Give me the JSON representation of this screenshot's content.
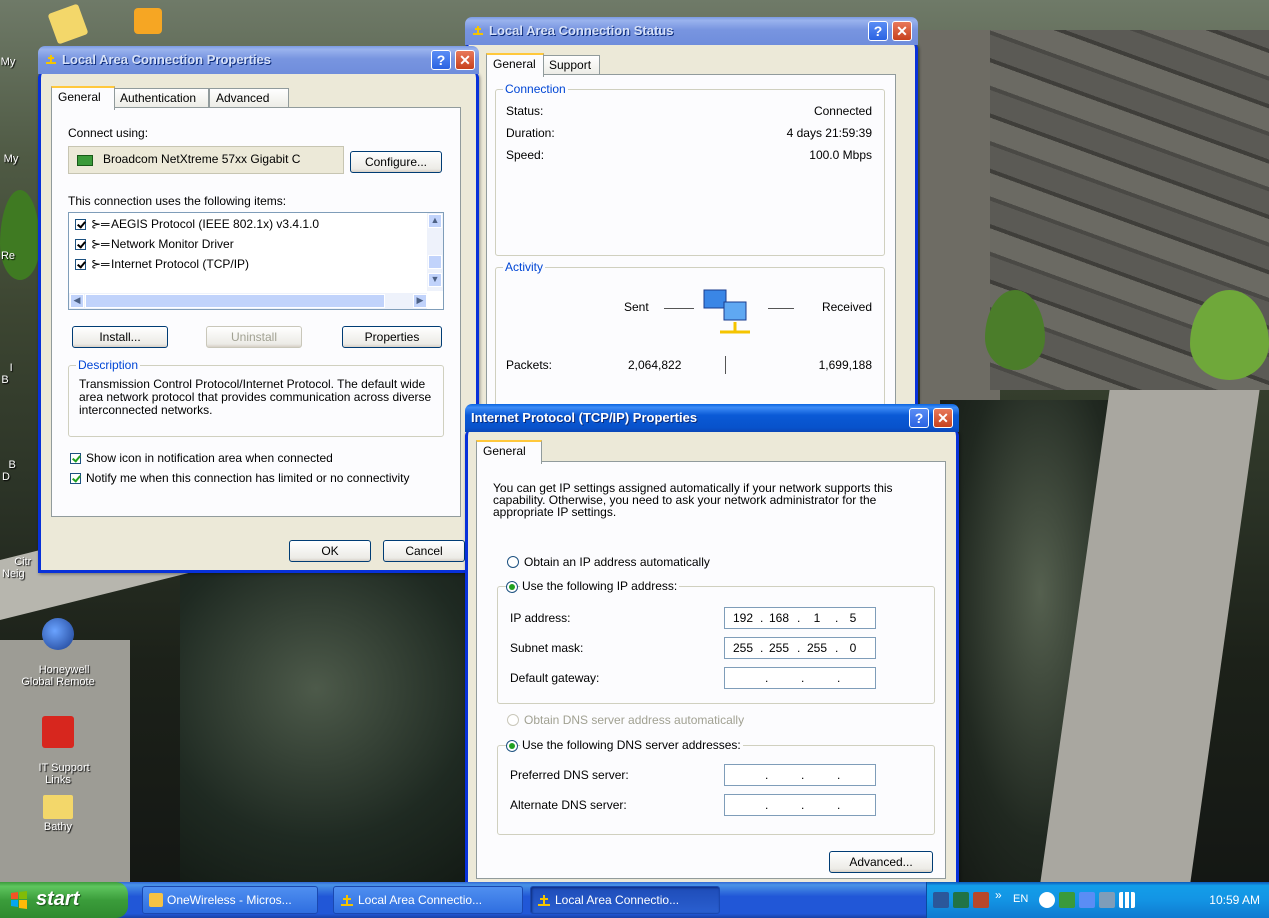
{
  "desktop": {
    "icons": [
      {
        "label": "My"
      },
      {
        "label": "My"
      },
      {
        "label": "Re"
      },
      {
        "label": "I\nB"
      },
      {
        "label": "B\nD"
      },
      {
        "label": "Citr\nNeig"
      },
      {
        "label": "Honeywell\nGlobal Remote"
      },
      {
        "label": "IT Support\nLinks"
      },
      {
        "label": "Bathy"
      }
    ]
  },
  "lac_properties": {
    "title": "Local Area Connection Properties",
    "tabs": [
      "General",
      "Authentication",
      "Advanced"
    ],
    "connect_using_label": "Connect using:",
    "adapter_name": "Broadcom NetXtreme 57xx Gigabit C",
    "configure_label": "Configure...",
    "items_label": "This connection uses the following items:",
    "items": [
      {
        "label": "AEGIS Protocol (IEEE 802.1x) v3.4.1.0"
      },
      {
        "label": "Network Monitor Driver"
      },
      {
        "label": "Internet Protocol (TCP/IP)"
      }
    ],
    "install_label": "Install...",
    "uninstall_label": "Uninstall",
    "properties_label": "Properties",
    "description_title": "Description",
    "description_text": "Transmission Control Protocol/Internet Protocol. The default wide area network protocol that provides communication across diverse interconnected networks.",
    "show_icon_label": "Show icon in notification area when connected",
    "notify_label": "Notify me when this connection has limited or no connectivity",
    "ok_label": "OK",
    "cancel_label": "Cancel"
  },
  "lac_status": {
    "title": "Local Area Connection Status",
    "tabs": [
      "General",
      "Support"
    ],
    "connection_title": "Connection",
    "status_label": "Status:",
    "status_value": "Connected",
    "duration_label": "Duration:",
    "duration_value": "4 days 21:59:39",
    "speed_label": "Speed:",
    "speed_value": "100.0 Mbps",
    "activity_title": "Activity",
    "sent_label": "Sent",
    "received_label": "Received",
    "packets_label": "Packets:",
    "packets_sent": "2,064,822",
    "packets_received": "1,699,188"
  },
  "tcpip": {
    "title": "Internet Protocol (TCP/IP) Properties",
    "tab": "General",
    "intro": "You can get IP settings assigned automatically if your network supports this capability. Otherwise, you need to ask your network administrator for the appropriate IP settings.",
    "obtain_ip_label": "Obtain an IP address automatically",
    "use_ip_label": "Use the following IP address:",
    "ip_label": "IP address:",
    "ip": [
      "192",
      "168",
      "1",
      "5"
    ],
    "subnet_label": "Subnet mask:",
    "subnet": [
      "255",
      "255",
      "255",
      "0"
    ],
    "gateway_label": "Default gateway:",
    "obtain_dns_label": "Obtain DNS server address automatically",
    "use_dns_label": "Use the following DNS server addresses:",
    "preferred_dns_label": "Preferred DNS server:",
    "alternate_dns_label": "Alternate DNS server:",
    "advanced_label": "Advanced..."
  },
  "taskbar": {
    "start_label": "start",
    "tasks": [
      {
        "label": "OneWireless - Micros..."
      },
      {
        "label": "Local Area Connectio..."
      },
      {
        "label": "Local Area Connectio..."
      }
    ],
    "lang": "EN",
    "clock": "10:59 AM"
  },
  "colors": {
    "title_active": "#0a5ad6",
    "title_inactive": "#7895e0",
    "dialog_bg": "#ece9d8",
    "group_title": "#0046d5",
    "start_green": "#3b9d3b",
    "tray_blue": "#1394e4"
  }
}
